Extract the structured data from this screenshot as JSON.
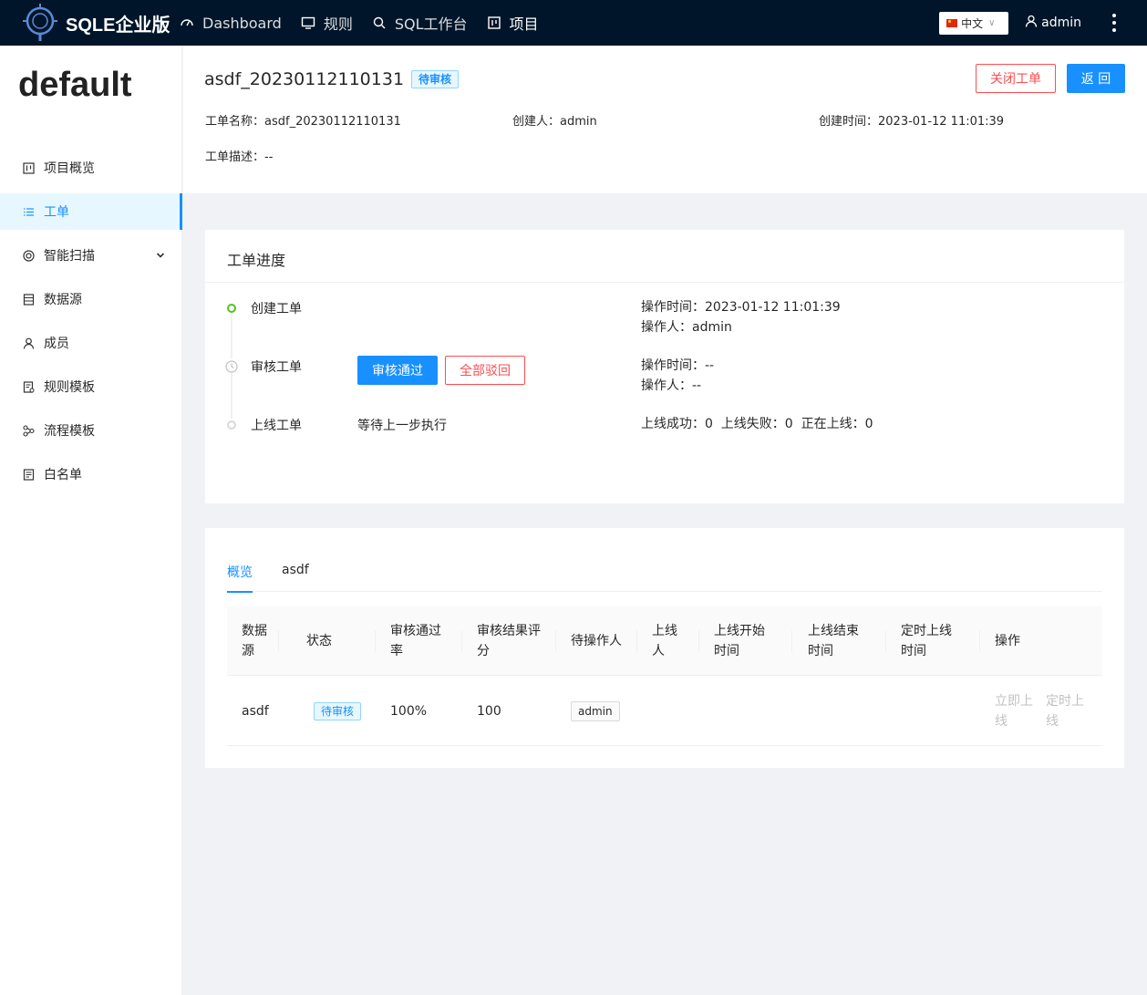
{
  "topbar": {
    "brand": "SQLE企业版",
    "nav": [
      {
        "label": "Dashboard",
        "icon": "dashboard-icon"
      },
      {
        "label": "规则",
        "icon": "monitor-icon"
      },
      {
        "label": "SQL工作台",
        "icon": "search-icon"
      },
      {
        "label": "项目",
        "icon": "project-icon"
      }
    ],
    "language": "中文",
    "user": "admin"
  },
  "sidebar": {
    "project": "default",
    "items": [
      {
        "label": "项目概览",
        "icon": "project-overview-icon"
      },
      {
        "label": "工单",
        "icon": "list-icon"
      },
      {
        "label": "智能扫描",
        "icon": "scan-icon"
      },
      {
        "label": "数据源",
        "icon": "database-icon"
      },
      {
        "label": "成员",
        "icon": "user-icon"
      },
      {
        "label": "规则模板",
        "icon": "rule-template-icon"
      },
      {
        "label": "流程模板",
        "icon": "flow-icon"
      },
      {
        "label": "白名单",
        "icon": "whitelist-icon"
      }
    ]
  },
  "order": {
    "title": "asdf_20230112110131",
    "status": "待审核",
    "close_label": "关闭工单",
    "back_label": "返 回",
    "name_line": "工单名称：asdf_20230112110131",
    "creator_line": "创建人：admin",
    "created_line": "创建时间：2023-01-12 11:01:39",
    "desc_line": "工单描述：--"
  },
  "progress": {
    "title": "工单进度",
    "steps": [
      {
        "name": "创建工单",
        "meta1": "操作时间：2023-01-12 11:01:39",
        "meta2": "操作人：admin"
      },
      {
        "name": "审核工单",
        "meta1": "操作时间：--",
        "meta2": "操作人：--",
        "approve": "审核通过",
        "reject": "全部驳回"
      },
      {
        "name": "上线工单",
        "waiting": "等待上一步执行",
        "meta1": "上线成功：0  上线失败：0  正在上线：0"
      }
    ]
  },
  "table": {
    "tabs": [
      "概览",
      "asdf"
    ],
    "headers": [
      "数据\n源",
      "状态",
      "审核通过\n率",
      "审核结果评\n分",
      "待操作人",
      "上线\n人",
      "上线开始\n时间",
      "上线结束\n时间",
      "定时上线\n时间",
      "操作"
    ],
    "row": {
      "datasource": "asdf",
      "status": "待审核",
      "pass_rate": "100%",
      "score": "100",
      "assignee": "admin",
      "action1": "立即上线",
      "action2": "定时上线"
    }
  },
  "colors": {
    "primary": "#1890ff",
    "danger": "#ff4d4f",
    "success": "#52c41a",
    "nav_bg": "#001529"
  }
}
